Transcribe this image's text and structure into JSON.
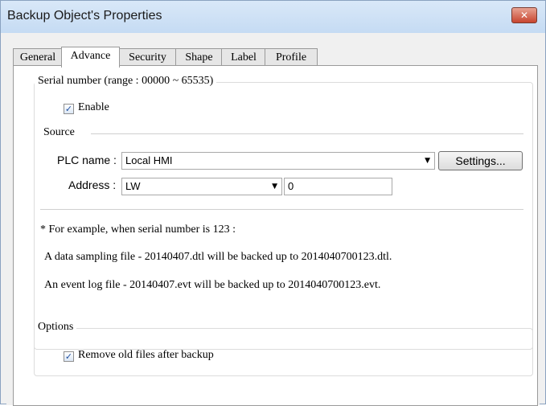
{
  "window": {
    "title": "Backup Object's Properties",
    "close_glyph": "✕"
  },
  "tabs": [
    {
      "label": "General"
    },
    {
      "label": "Advance"
    },
    {
      "label": "Security"
    },
    {
      "label": "Shape"
    },
    {
      "label": "Label"
    },
    {
      "label": "Profile"
    }
  ],
  "active_tab": "Advance",
  "serial": {
    "legend": "Serial number (range : 00000 ~ 65535)",
    "enable_label": "Enable",
    "enable_checked": true,
    "source_label": "Source",
    "plc_name_label": "PLC name :",
    "plc_name_value": "Local HMI",
    "settings_label": "Settings...",
    "address_label": "Address :",
    "address_type_value": "LW",
    "address_value": "0",
    "example_heading": "* For example, when serial number is 123 :",
    "example_line1": "A data sampling file - 20140407.dtl will be backed up to 2014040700123.dtl.",
    "example_line2": "An event log file - 20140407.evt will be backed up to 2014040700123.evt."
  },
  "options": {
    "legend": "Options",
    "remove_old_label": "Remove old files after backup",
    "remove_old_checked": true
  },
  "check_glyph": "✓",
  "dropdown_glyph": "▼",
  "colors": {
    "title_bar": "#c5dbf3",
    "close_button": "#c8452f",
    "check": "#1f4fa0"
  }
}
